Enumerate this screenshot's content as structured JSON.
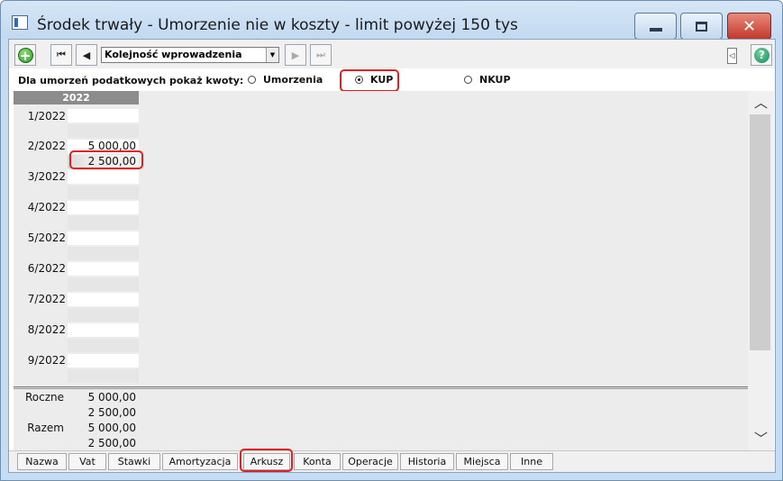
{
  "window": {
    "title": "Środek trwały - Umorzenie nie w koszty - limit powyżej 150 tys",
    "minimize_label": "",
    "maximize_label": "",
    "close_label": "✕"
  },
  "toolbar": {
    "add_label": "+",
    "first_label": "⏮",
    "prev_label": "◀",
    "sort_value": "Kolejność wprowadzenia",
    "sort_arrow": "▼",
    "next_label": "▶",
    "last_label": "⏭",
    "collapse_label": "◁",
    "help_label": "?"
  },
  "filter": {
    "label": "Dla umorzeń podatkowych pokaż kwoty:",
    "options": [
      {
        "label": "Umorzenia",
        "checked": false
      },
      {
        "label": "KUP",
        "checked": true
      },
      {
        "label": "NKUP",
        "checked": false
      }
    ]
  },
  "grid": {
    "year": "2022",
    "months": [
      {
        "label": "1/2022",
        "top": "",
        "bottom": ""
      },
      {
        "label": "2/2022",
        "top": "5 000,00",
        "bottom": "2 500,00"
      },
      {
        "label": "3/2022",
        "top": "",
        "bottom": ""
      },
      {
        "label": "4/2022",
        "top": "",
        "bottom": ""
      },
      {
        "label": "5/2022",
        "top": "",
        "bottom": ""
      },
      {
        "label": "6/2022",
        "top": "",
        "bottom": ""
      },
      {
        "label": "7/2022",
        "top": "",
        "bottom": ""
      },
      {
        "label": "8/2022",
        "top": "",
        "bottom": ""
      },
      {
        "label": "9/2022",
        "top": "",
        "bottom": ""
      }
    ]
  },
  "totals": {
    "yearly_label": "Roczne",
    "yearly_top": "5 000,00",
    "yearly_bottom": "2 500,00",
    "total_label": "Razem",
    "total_top": "5 000,00",
    "total_bottom": "2 500,00"
  },
  "scroll": {
    "up": "︿",
    "down": "﹀"
  },
  "tabs": [
    "Nazwa",
    "Vat",
    "Stawki",
    "Amortyzacja",
    "Arkusz",
    "Konta",
    "Operacje",
    "Historia",
    "Miejsca",
    "Inne"
  ],
  "colors": {
    "highlight": "#e02020",
    "header_bg": "#8c8c8c"
  }
}
